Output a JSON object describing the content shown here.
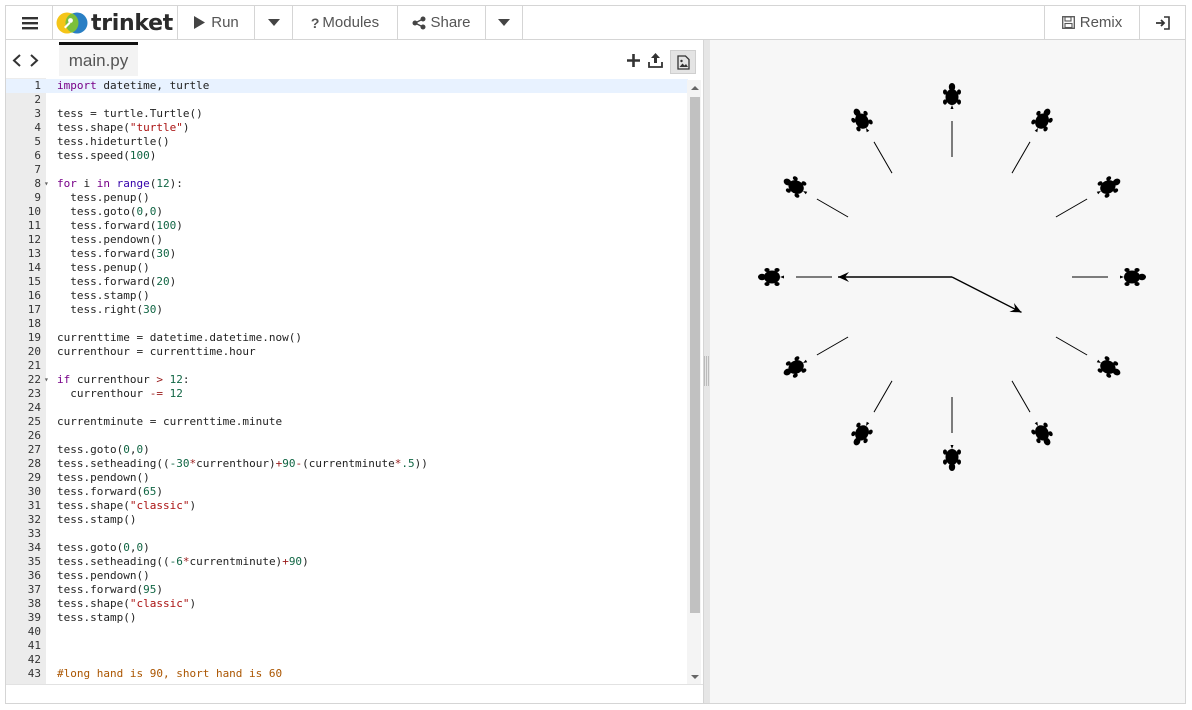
{
  "toolbar": {
    "brand": "trinket",
    "run_label": "Run",
    "modules_label": "Modules",
    "share_label": "Share",
    "remix_label": "Remix"
  },
  "editor": {
    "filename": "main.py",
    "lines": [
      [
        [
          "kw",
          "import"
        ],
        [
          "t",
          " datetime, turtle"
        ]
      ],
      [],
      [
        [
          "t",
          "tess = turtle.Turtle()"
        ]
      ],
      [
        [
          "t",
          "tess.shape("
        ],
        [
          "s",
          "\"turtle\""
        ],
        [
          "t",
          ")"
        ]
      ],
      [
        [
          "t",
          "tess.hideturtle()"
        ]
      ],
      [
        [
          "t",
          "tess.speed("
        ],
        [
          "n",
          "100"
        ],
        [
          "t",
          ")"
        ]
      ],
      [],
      [
        [
          "kw",
          "for"
        ],
        [
          "t",
          " i "
        ],
        [
          "kw",
          "in"
        ],
        [
          "t",
          " "
        ],
        [
          "b",
          "range"
        ],
        [
          "t",
          "("
        ],
        [
          "n",
          "12"
        ],
        [
          "t",
          "):"
        ]
      ],
      [
        [
          "t",
          "  tess.penup()"
        ]
      ],
      [
        [
          "t",
          "  tess.goto("
        ],
        [
          "n",
          "0"
        ],
        [
          "t",
          ","
        ],
        [
          "n",
          "0"
        ],
        [
          "t",
          ")"
        ]
      ],
      [
        [
          "t",
          "  tess.forward("
        ],
        [
          "n",
          "100"
        ],
        [
          "t",
          ")"
        ]
      ],
      [
        [
          "t",
          "  tess.pendown()"
        ]
      ],
      [
        [
          "t",
          "  tess.forward("
        ],
        [
          "n",
          "30"
        ],
        [
          "t",
          ")"
        ]
      ],
      [
        [
          "t",
          "  tess.penup()"
        ]
      ],
      [
        [
          "t",
          "  tess.forward("
        ],
        [
          "n",
          "20"
        ],
        [
          "t",
          ")"
        ]
      ],
      [
        [
          "t",
          "  tess.stamp()"
        ]
      ],
      [
        [
          "t",
          "  tess.right("
        ],
        [
          "n",
          "30"
        ],
        [
          "t",
          ")"
        ]
      ],
      [],
      [
        [
          "t",
          "currenttime = datetime.datetime.now()"
        ]
      ],
      [
        [
          "t",
          "currenthour = currenttime.hour"
        ]
      ],
      [],
      [
        [
          "kw",
          "if"
        ],
        [
          "t",
          " currenthour "
        ],
        [
          "o",
          ">"
        ],
        [
          "t",
          " "
        ],
        [
          "n",
          "12"
        ],
        [
          "t",
          ":"
        ]
      ],
      [
        [
          "t",
          "  currenthour "
        ],
        [
          "o",
          "-="
        ],
        [
          "t",
          " "
        ],
        [
          "n",
          "12"
        ]
      ],
      [],
      [
        [
          "t",
          "currentminute = currenttime.minute"
        ]
      ],
      [],
      [
        [
          "t",
          "tess.goto("
        ],
        [
          "n",
          "0"
        ],
        [
          "t",
          ","
        ],
        [
          "n",
          "0"
        ],
        [
          "t",
          ")"
        ]
      ],
      [
        [
          "t",
          "tess.setheading(("
        ],
        [
          "n",
          "-30"
        ],
        [
          "o",
          "*"
        ],
        [
          "t",
          "currenthour)"
        ],
        [
          "o",
          "+"
        ],
        [
          "n",
          "90"
        ],
        [
          "o",
          "-"
        ],
        [
          "t",
          "(currentminute"
        ],
        [
          "o",
          "*"
        ],
        [
          "n",
          ".5"
        ],
        [
          "t",
          "))"
        ]
      ],
      [
        [
          "t",
          "tess.pendown()"
        ]
      ],
      [
        [
          "t",
          "tess.forward("
        ],
        [
          "n",
          "65"
        ],
        [
          "t",
          ")"
        ]
      ],
      [
        [
          "t",
          "tess.shape("
        ],
        [
          "s",
          "\"classic\""
        ],
        [
          "t",
          ")"
        ]
      ],
      [
        [
          "t",
          "tess.stamp()"
        ]
      ],
      [],
      [
        [
          "t",
          "tess.goto("
        ],
        [
          "n",
          "0"
        ],
        [
          "t",
          ","
        ],
        [
          "n",
          "0"
        ],
        [
          "t",
          ")"
        ]
      ],
      [
        [
          "t",
          "tess.setheading(("
        ],
        [
          "n",
          "-6"
        ],
        [
          "o",
          "*"
        ],
        [
          "t",
          "currentminute)"
        ],
        [
          "o",
          "+"
        ],
        [
          "n",
          "90"
        ],
        [
          "t",
          ")"
        ]
      ],
      [
        [
          "t",
          "tess.pendown()"
        ]
      ],
      [
        [
          "t",
          "tess.forward("
        ],
        [
          "n",
          "95"
        ],
        [
          "t",
          ")"
        ]
      ],
      [
        [
          "t",
          "tess.shape("
        ],
        [
          "s",
          "\"classic\""
        ],
        [
          "t",
          ")"
        ]
      ],
      [
        [
          "t",
          "tess.stamp()"
        ]
      ],
      [],
      [],
      [],
      [
        [
          "c",
          "#long hand is 90, short hand is 60"
        ]
      ]
    ],
    "fold_lines": [
      8,
      22
    ]
  },
  "colors": {
    "kw": "#770088",
    "n": "#116644",
    "s": "#aa1111",
    "c": "#aa5500",
    "o": "#981a1a",
    "b": "#3300aa",
    "t": "#222222",
    "logo_yellow": "#f5c518",
    "logo_blue": "#2a7fc4"
  },
  "output": {
    "turtle_angles_deg": [
      90,
      60,
      30,
      0,
      -30,
      -60,
      -90,
      -120,
      -150,
      180,
      150,
      120
    ],
    "hour_hand_heading_deg": -27,
    "minute_hand_heading_deg": 180
  }
}
